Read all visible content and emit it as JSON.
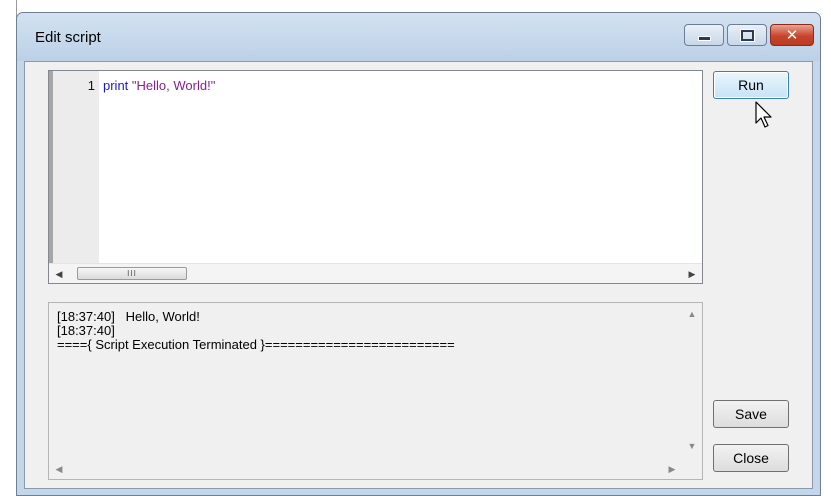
{
  "window": {
    "title": "Edit script"
  },
  "editor": {
    "lines": [
      {
        "number": "1",
        "keyword": "print",
        "string": "\"Hello, World!\""
      }
    ],
    "scroll_thumb_grip": "III"
  },
  "output": {
    "text": "[18:37:40]   Hello, World!\n[18:37:40]\n===={ Script Execution Terminated }========================="
  },
  "buttons": {
    "run": "Run",
    "save": "Save",
    "close": "Close"
  },
  "colors": {
    "keyword": "#1f18c9",
    "string": "#8a1f8e"
  }
}
